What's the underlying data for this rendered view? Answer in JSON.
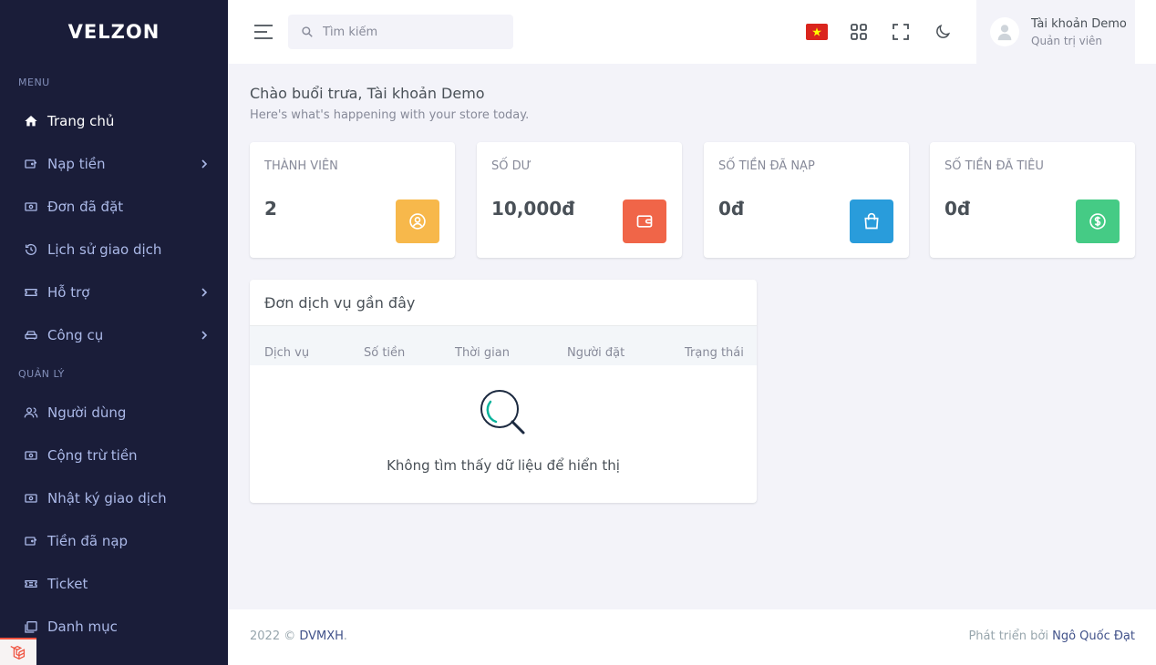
{
  "brand": {
    "name": "VELZON"
  },
  "sidebar": {
    "sections": [
      {
        "title": "MENU",
        "items": [
          {
            "label": "Trang chủ",
            "icon": "home-icon",
            "active": true,
            "has_children": false
          },
          {
            "label": "Nạp tiền",
            "icon": "wallet-add-icon",
            "has_children": true
          },
          {
            "label": "Đơn đã đặt",
            "icon": "money-icon",
            "has_children": false
          },
          {
            "label": "Lịch sử giao dịch",
            "icon": "history-icon",
            "has_children": false
          },
          {
            "label": "Hỗ trợ",
            "icon": "ticket-icon",
            "has_children": true
          },
          {
            "label": "Công cụ",
            "icon": "car-icon",
            "has_children": true
          }
        ]
      },
      {
        "title": "QUẢN LÝ",
        "items": [
          {
            "label": "Người dùng",
            "icon": "users-icon",
            "has_children": false
          },
          {
            "label": "Cộng trừ tiền",
            "icon": "money-icon",
            "has_children": false
          },
          {
            "label": "Nhật ký giao dịch",
            "icon": "money-icon",
            "has_children": false
          },
          {
            "label": "Tiền đã nạp",
            "icon": "wallet-add-icon",
            "has_children": false
          },
          {
            "label": "Ticket",
            "icon": "ticket-icon",
            "has_children": false
          },
          {
            "label": "Danh mục",
            "icon": "folder-icon",
            "has_children": false
          }
        ]
      }
    ]
  },
  "topbar": {
    "search_placeholder": "Tìm kiếm",
    "user": {
      "name": "Tài khoản Demo",
      "role": "Quản trị viên"
    }
  },
  "main": {
    "greeting": "Chào buổi trưa, Tài khoản Demo",
    "sub_greeting": "Here's what's happening with your store today.",
    "stats": [
      {
        "label": "THÀNH VIÊN",
        "value": "2",
        "icon": "user-circle-icon",
        "color": "#f7b84b"
      },
      {
        "label": "SỐ DƯ",
        "value": "10,000đ",
        "icon": "wallet-icon",
        "color": "#f06548"
      },
      {
        "label": "SỐ TIỀN ĐÃ NẠP",
        "value": "0đ",
        "icon": "shopping-bag-icon",
        "color": "#299cdb"
      },
      {
        "label": "SỐ TIỀN ĐÃ TIÊU",
        "value": "0đ",
        "icon": "dollar-circle-icon",
        "color": "#45cb85"
      }
    ],
    "orders": {
      "title": "Đơn dịch vụ gần đây",
      "columns": [
        "Dịch vụ",
        "Số tiền",
        "Thời gian",
        "Người đặt",
        "Trạng thái"
      ],
      "empty_text": "Không tìm thấy dữ liệu để hiển thị"
    }
  },
  "footer": {
    "year": "2022 ©",
    "site": "DVMXH",
    "dot": ".",
    "dev_prefix": "Phát triển bởi",
    "dev_name": "Ngô Quốc Đạt"
  }
}
